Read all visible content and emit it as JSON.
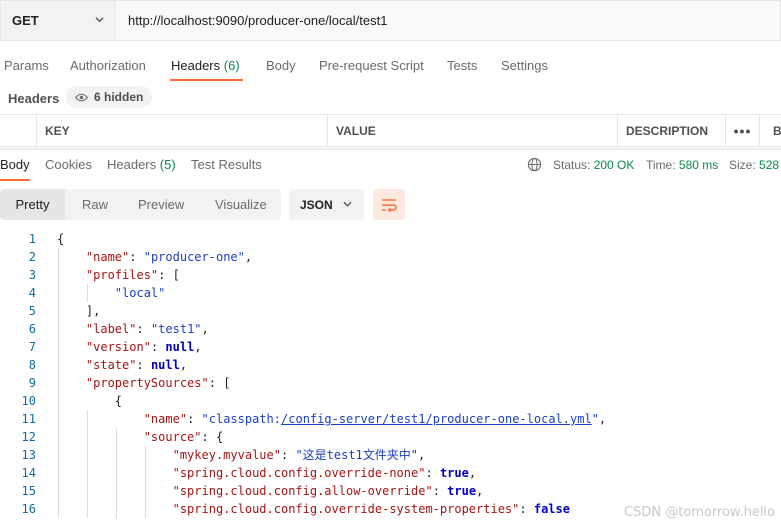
{
  "request": {
    "method": "GET",
    "url": "http://localhost:9090/producer-one/local/test1"
  },
  "request_tabs": {
    "params": "Params",
    "authorization": "Authorization",
    "headers": "Headers",
    "headers_count": "(6)",
    "body": "Body",
    "prerequest": "Pre-request Script",
    "tests": "Tests",
    "settings": "Settings"
  },
  "headers_section": {
    "label": "Headers",
    "hidden": "6 hidden"
  },
  "table": {
    "key": "KEY",
    "value": "VALUE",
    "description": "DESCRIPTION",
    "more": "•••",
    "bulk": "B"
  },
  "response_tabs": {
    "body": "Body",
    "cookies": "Cookies",
    "headers": "Headers",
    "headers_count": "(5)",
    "test_results": "Test Results"
  },
  "response_meta": {
    "status_label": "Status:",
    "status_value": "200 OK",
    "time_label": "Time:",
    "time_value": "580 ms",
    "size_label": "Size:",
    "size_value": "528"
  },
  "view": {
    "pretty": "Pretty",
    "raw": "Raw",
    "preview": "Preview",
    "visualize": "Visualize",
    "format": "JSON"
  },
  "code_lines": [
    {
      "n": "1",
      "t": "{"
    },
    {
      "n": "2",
      "t": "    \"name\": \"producer-one\","
    },
    {
      "n": "3",
      "t": "    \"profiles\": ["
    },
    {
      "n": "4",
      "t": "        \"local\""
    },
    {
      "n": "5",
      "t": "    ],"
    },
    {
      "n": "6",
      "t": "    \"label\": \"test1\","
    },
    {
      "n": "7",
      "t": "    \"version\": null,"
    },
    {
      "n": "8",
      "t": "    \"state\": null,"
    },
    {
      "n": "9",
      "t": "    \"propertySources\": ["
    },
    {
      "n": "10",
      "t": "        {"
    },
    {
      "n": "11",
      "t": "            \"name\": \"classpath:/config-server/test1/producer-one-local.yml\","
    },
    {
      "n": "12",
      "t": "            \"source\": {"
    },
    {
      "n": "13",
      "t": "                \"mykey.myvalue\": \"这是test1文件夹中\","
    },
    {
      "n": "14",
      "t": "                \"spring.cloud.config.override-none\": true,"
    },
    {
      "n": "15",
      "t": "                \"spring.cloud.config.allow-override\": true,"
    },
    {
      "n": "16",
      "t": "                \"spring.cloud.config.override-system-properties\": false"
    }
  ],
  "watermark": "CSDN @tomorrow.hello",
  "colors": {
    "accent": "#ff6c37",
    "success": "#0a8a4a",
    "json_key": "#a31515",
    "json_string": "#1c3fbf",
    "line_number": "#0b6f9e"
  }
}
